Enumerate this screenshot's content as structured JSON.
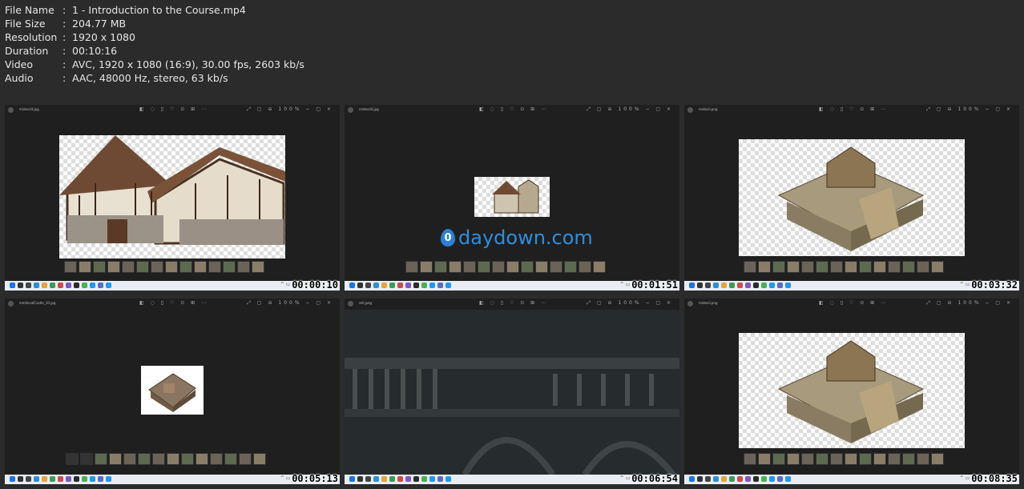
{
  "meta": {
    "rows": [
      {
        "key": "File Name",
        "value": "1 - Introduction to the Course.mp4"
      },
      {
        "key": "File Size",
        "value": "204.77 MB"
      },
      {
        "key": "Resolution",
        "value": "1920 x 1080"
      },
      {
        "key": "Duration",
        "value": "00:10:16"
      },
      {
        "key": "Video",
        "value": "AVC, 1920 x 1080 (16:9), 30.00 fps, 2603 kb/s"
      },
      {
        "key": "Audio",
        "value": "AAC, 48000 Hz, stereo, 63 kb/s"
      }
    ],
    "separator": ":"
  },
  "thumbs": [
    {
      "timestamp": "00:00:10",
      "filename": "midevil4.jpg",
      "zoom": "100%"
    },
    {
      "timestamp": "00:01:51",
      "filename": "midevil4.jpg",
      "zoom": "100%"
    },
    {
      "timestamp": "00:03:32",
      "filename": "midevil.png",
      "zoom": "100%"
    },
    {
      "timestamp": "00:05:13",
      "filename": "medievalCastle_10.jpg",
      "zoom": "100%"
    },
    {
      "timestamp": "00:06:54",
      "filename": "set.jpeg",
      "zoom": "100%"
    },
    {
      "timestamp": "00:08:35",
      "filename": "midevil.png",
      "zoom": "100%"
    }
  ],
  "watermark": {
    "digit": "0",
    "text": "daydown.com"
  },
  "colors": {
    "background": "#2b2b2b",
    "viewer": "#1f1f1f",
    "taskbar": "#e9ecf2",
    "watermark": "#2d8fe0"
  }
}
